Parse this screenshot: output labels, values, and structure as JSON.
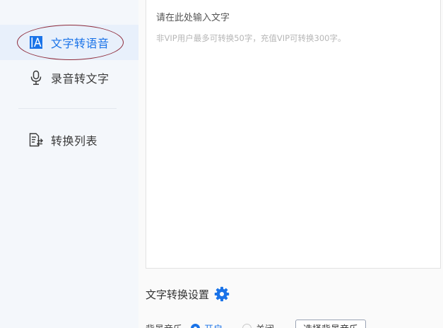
{
  "sidebar": {
    "items": [
      {
        "label": "文字转语音",
        "icon": "text-to-speech-icon",
        "active": true
      },
      {
        "label": "录音转文字",
        "icon": "microphone-icon",
        "active": false
      },
      {
        "label": "转换列表",
        "icon": "list-document-icon",
        "active": false
      }
    ]
  },
  "editor": {
    "placeholder": "请在此处输入文字",
    "hint": "非VIP用户最多可转换50字，充值VIP可转换300字。"
  },
  "settings": {
    "title": "文字转换设置",
    "icon": "gear-icon",
    "background_music_label": "背景音乐",
    "option_on": "开启",
    "option_off": "关闭",
    "select_music_button": "选择背景音乐"
  },
  "colors": {
    "accent": "#1a73e8",
    "sidebar_bg": "#f4f7fb",
    "active_bg": "#e8f0fb",
    "annotation": "#8e2a3a"
  }
}
